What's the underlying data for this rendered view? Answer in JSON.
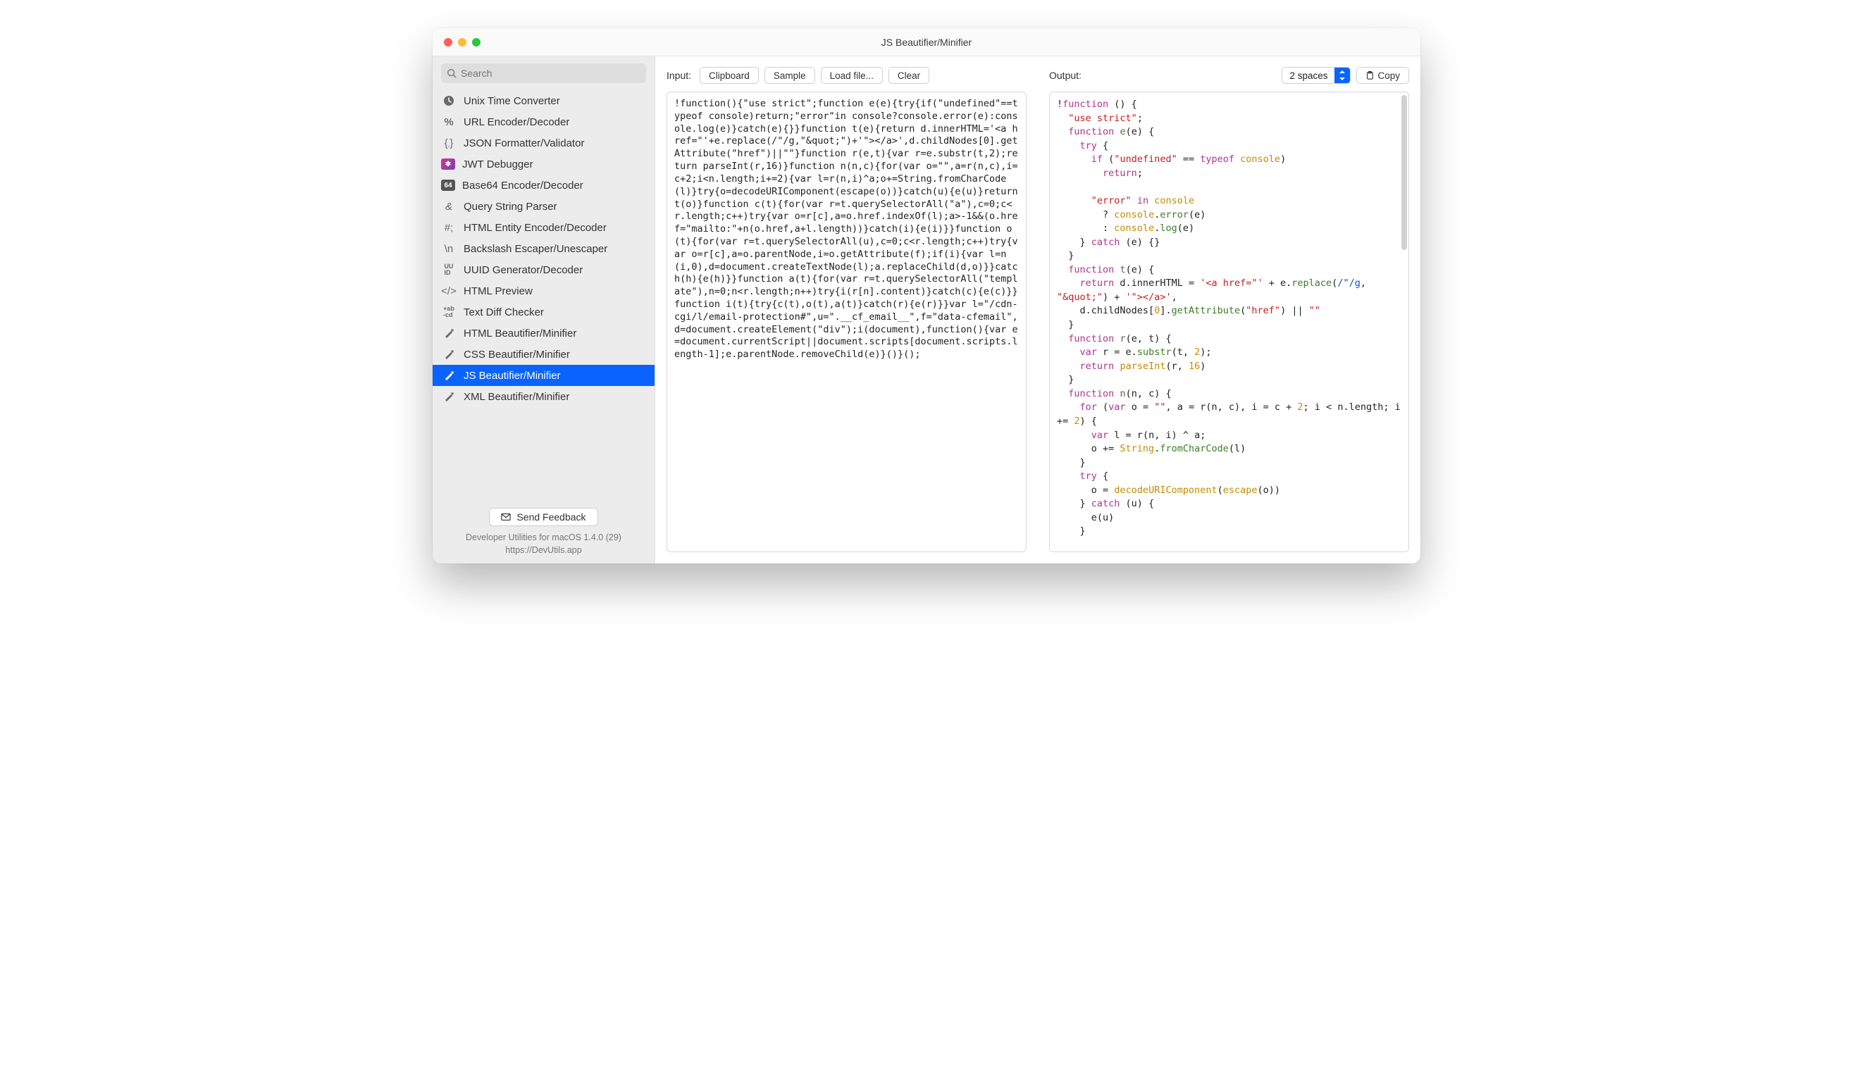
{
  "window": {
    "title": "JS Beautifier/Minifier"
  },
  "search": {
    "placeholder": "Search"
  },
  "sidebar": {
    "items": [
      {
        "icon": "clock",
        "label": "Unix Time Converter"
      },
      {
        "icon": "percent",
        "label": "URL Encoder/Decoder"
      },
      {
        "icon": "braces",
        "label": "JSON Formatter/Validator"
      },
      {
        "icon": "jwt",
        "label": "JWT Debugger"
      },
      {
        "icon": "b64",
        "label": "Base64 Encoder/Decoder"
      },
      {
        "icon": "amp",
        "label": "Query String Parser"
      },
      {
        "icon": "hash",
        "label": "HTML Entity Encoder/Decoder"
      },
      {
        "icon": "backslash",
        "label": "Backslash Escaper/Unescaper"
      },
      {
        "icon": "uuid",
        "label": "UUID Generator/Decoder"
      },
      {
        "icon": "tag",
        "label": "HTML Preview"
      },
      {
        "icon": "diff",
        "label": "Text Diff Checker"
      },
      {
        "icon": "wand",
        "label": "HTML Beautifier/Minifier"
      },
      {
        "icon": "wand",
        "label": "CSS Beautifier/Minifier"
      },
      {
        "icon": "wand",
        "label": "JS Beautifier/Minifier",
        "selected": true
      },
      {
        "icon": "wand",
        "label": "XML Beautifier/Minifier"
      }
    ]
  },
  "footer": {
    "feedback": "Send Feedback",
    "version": "Developer Utilities for macOS 1.4.0 (29)",
    "url": "https://DevUtils.app"
  },
  "input": {
    "label": "Input:",
    "buttons": {
      "clipboard": "Clipboard",
      "sample": "Sample",
      "load": "Load file...",
      "clear": "Clear"
    },
    "text": "!function(){\"use strict\";function e(e){try{if(\"undefined\"==typeof console)return;\"error\"in console?console.error(e):console.log(e)}catch(e){}}function t(e){return d.innerHTML='<a href=\"'+e.replace(/\"/g,\"&quot;\")+'\"></a>',d.childNodes[0].getAttribute(\"href\")||\"\"}function r(e,t){var r=e.substr(t,2);return parseInt(r,16)}function n(n,c){for(var o=\"\",a=r(n,c),i=c+2;i<n.length;i+=2){var l=r(n,i)^a;o+=String.fromCharCode(l)}try{o=decodeURIComponent(escape(o))}catch(u){e(u)}return t(o)}function c(t){for(var r=t.querySelectorAll(\"a\"),c=0;c<r.length;c++)try{var o=r[c],a=o.href.indexOf(l);a>-1&&(o.href=\"mailto:\"+n(o.href,a+l.length))}catch(i){e(i)}}function o(t){for(var r=t.querySelectorAll(u),c=0;c<r.length;c++)try{var o=r[c],a=o.parentNode,i=o.getAttribute(f);if(i){var l=n(i,0),d=document.createTextNode(l);a.replaceChild(d,o)}}catch(h){e(h)}}function a(t){for(var r=t.querySelectorAll(\"template\"),n=0;n<r.length;n++)try{i(r[n].content)}catch(c){e(c)}}function i(t){try{c(t),o(t),a(t)}catch(r){e(r)}}var l=\"/cdn-cgi/l/email-protection#\",u=\".__cf_email__\",f=\"data-cfemail\",d=document.createElement(\"div\");i(document),function(){var e=document.currentScript||document.scripts[document.scripts.length-1];e.parentNode.removeChild(e)}()}();"
  },
  "output": {
    "label": "Output:",
    "indent": "2 spaces",
    "copy": "Copy"
  }
}
